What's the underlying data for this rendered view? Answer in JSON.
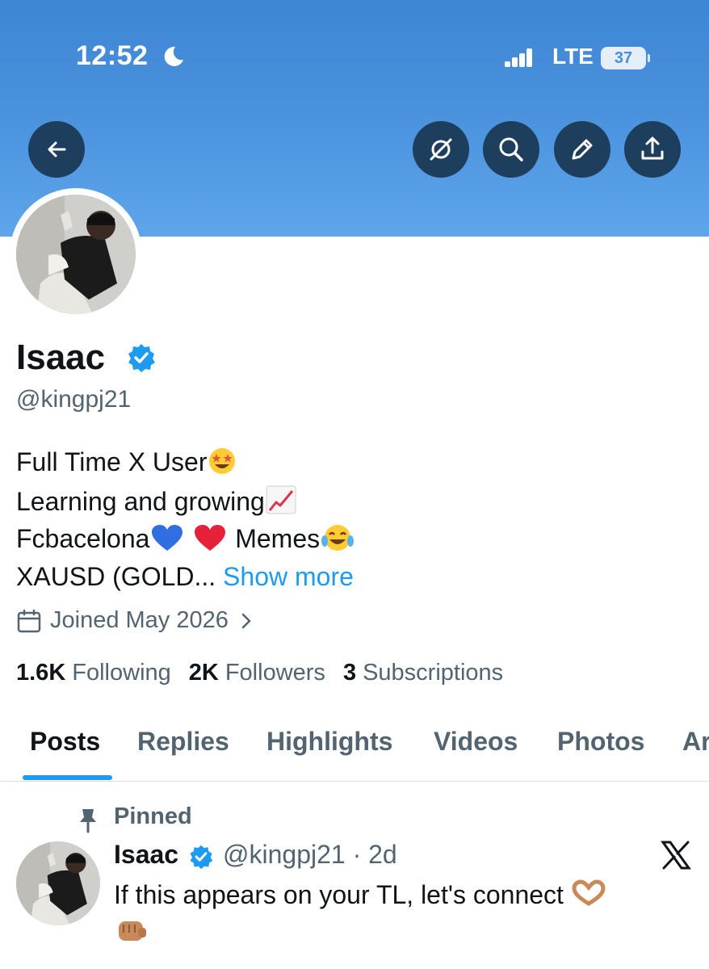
{
  "status_bar": {
    "time": "12:52",
    "network": "LTE",
    "battery": "37",
    "battery_level": 0.37,
    "icons": [
      "moon-icon",
      "signal-icon",
      "battery-icon"
    ]
  },
  "header_actions": {
    "icons": [
      "back-arrow-icon",
      "grok-icon",
      "search-icon",
      "edit-icon",
      "share-icon"
    ]
  },
  "profile": {
    "name": "Isaac",
    "handle": "@kingpj21",
    "bio": {
      "line1": "Full Time X User",
      "line2": "Learning and growing",
      "line3_a": "Fcbacelona",
      "line3_b": "Memes",
      "line4": "XAUSD (GOLD...",
      "show_more": "Show more"
    },
    "joined": "Joined May 2026",
    "following_count": "1.6K",
    "following_label": "Following",
    "followers_count": "2K",
    "followers_label": "Followers",
    "subscriptions_count": "3",
    "subscriptions_label": "Subscriptions"
  },
  "tabs": [
    {
      "label": "Posts",
      "active": true
    },
    {
      "label": "Replies"
    },
    {
      "label": "Highlights"
    },
    {
      "label": "Videos"
    },
    {
      "label": "Photos"
    },
    {
      "label": "Ar"
    }
  ],
  "pinned_post": {
    "pinned_label": "Pinned",
    "author": "Isaac",
    "handle_time": "@kingpj21 · 2d",
    "text": "If this appears on your TL, let's connect"
  },
  "colors": {
    "banner": "#4a91dc",
    "button_bg": "#1e3e5e",
    "accent": "#1d9bf0",
    "text": "#0f1419",
    "muted": "#536471"
  }
}
